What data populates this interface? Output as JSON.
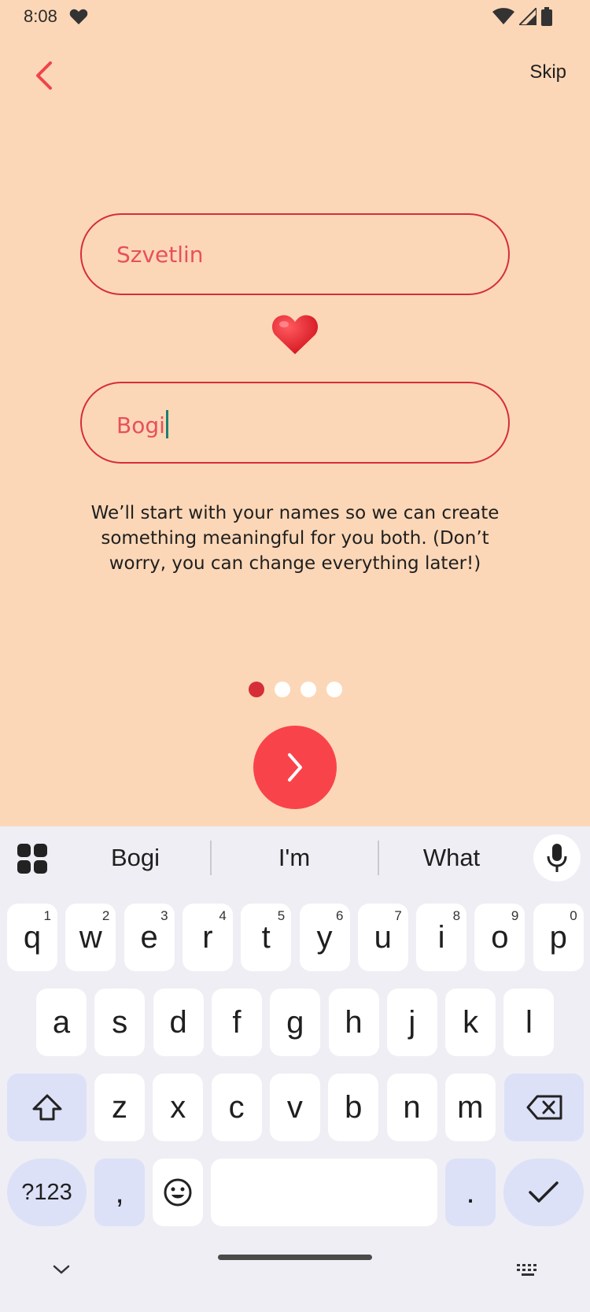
{
  "status": {
    "time": "8:08"
  },
  "nav": {
    "skip_label": "Skip"
  },
  "fields": {
    "partner1": "Szvetlin",
    "partner2": "Bogi"
  },
  "helper_text": "We’ll start with your names so we can create something meaningful for you both. (Don’t worry, you can change everything later!)",
  "pager": {
    "total": 4,
    "active": 0
  },
  "colors": {
    "background": "#FCD7B7",
    "accent": "#F9434B",
    "border": "#D62E38"
  },
  "keyboard": {
    "suggestions": [
      "Bogi",
      "I'm",
      "What"
    ],
    "row1": [
      {
        "k": "q",
        "h": "1"
      },
      {
        "k": "w",
        "h": "2"
      },
      {
        "k": "e",
        "h": "3"
      },
      {
        "k": "r",
        "h": "4"
      },
      {
        "k": "t",
        "h": "5"
      },
      {
        "k": "y",
        "h": "6"
      },
      {
        "k": "u",
        "h": "7"
      },
      {
        "k": "i",
        "h": "8"
      },
      {
        "k": "o",
        "h": "9"
      },
      {
        "k": "p",
        "h": "0"
      }
    ],
    "row2": [
      "a",
      "s",
      "d",
      "f",
      "g",
      "h",
      "j",
      "k",
      "l"
    ],
    "row3": [
      "z",
      "x",
      "c",
      "v",
      "b",
      "n",
      "m"
    ],
    "symbols_label": "?123",
    "comma_label": ",",
    "period_label": "."
  }
}
